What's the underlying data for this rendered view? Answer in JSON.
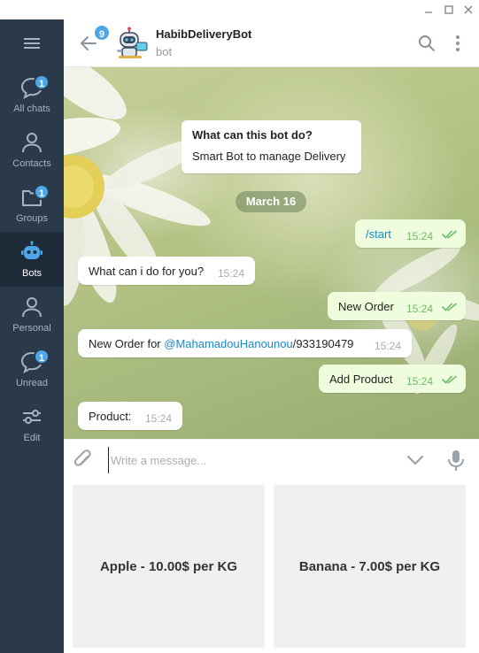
{
  "window": {
    "minimize_icon": "minimize-icon",
    "maximize_icon": "maximize-icon",
    "close_icon": "close-icon"
  },
  "sidebar": {
    "menu_icon": "hamburger-menu-icon",
    "folders": [
      {
        "label": "All chats",
        "icon": "chat-bubble-icon",
        "badge": "1",
        "active": false
      },
      {
        "label": "Contacts",
        "icon": "person-icon",
        "badge": "",
        "active": false
      },
      {
        "label": "Groups",
        "icon": "folder-icon",
        "badge": "1",
        "active": false
      },
      {
        "label": "Bots",
        "icon": "robot-icon",
        "badge": "",
        "active": true
      },
      {
        "label": "Personal",
        "icon": "person-icon",
        "badge": "",
        "active": false
      },
      {
        "label": "Unread",
        "icon": "chat-bubble-icon",
        "badge": "1",
        "active": false
      },
      {
        "label": "Edit",
        "icon": "sliders-icon",
        "badge": "",
        "active": false
      }
    ]
  },
  "header": {
    "back_icon": "back-arrow-icon",
    "unread_count": "9",
    "title": "HabibDeliveryBot",
    "subtitle": "bot",
    "avatar_icon": "robot-avatar-icon",
    "search_icon": "search-icon",
    "more_icon": "more-vertical-icon"
  },
  "bot_info": {
    "title": "What can this bot do?",
    "text": "Smart Bot to manage Delivery"
  },
  "date_separator": "March 16",
  "messages": [
    {
      "direction": "out",
      "text": "/start",
      "time": "15:24",
      "read": true
    },
    {
      "direction": "in",
      "text": "What can i do for you?",
      "time": "15:24"
    },
    {
      "direction": "out",
      "text": "New Order",
      "time": "15:24",
      "read": true
    },
    {
      "direction": "in",
      "text_prefix": "New Order for ",
      "mention": "@MahamadouHanounou",
      "text_suffix": "/933190479",
      "time": "15:24"
    },
    {
      "direction": "out",
      "text": "Add Product",
      "time": "15:24",
      "read": true
    },
    {
      "direction": "in",
      "text": "Product:",
      "time": "15:24"
    }
  ],
  "composer": {
    "placeholder": "Write a message...",
    "attach_icon": "paperclip-icon",
    "keyboard_toggle_icon": "chevron-down-icon",
    "mic_icon": "microphone-icon"
  },
  "keyboard": {
    "buttons": [
      {
        "label": "Apple - 10.00$ per KG"
      },
      {
        "label": "Banana - 7.00$ per KG"
      }
    ]
  },
  "colors": {
    "sidebar_bg": "#2b3a4a",
    "sidebar_active_bg": "#1e2c3a",
    "accent": "#4da6e8",
    "link": "#168acd",
    "outgoing_bubble": "#effdde",
    "time_outgoing": "#6dbb68"
  }
}
